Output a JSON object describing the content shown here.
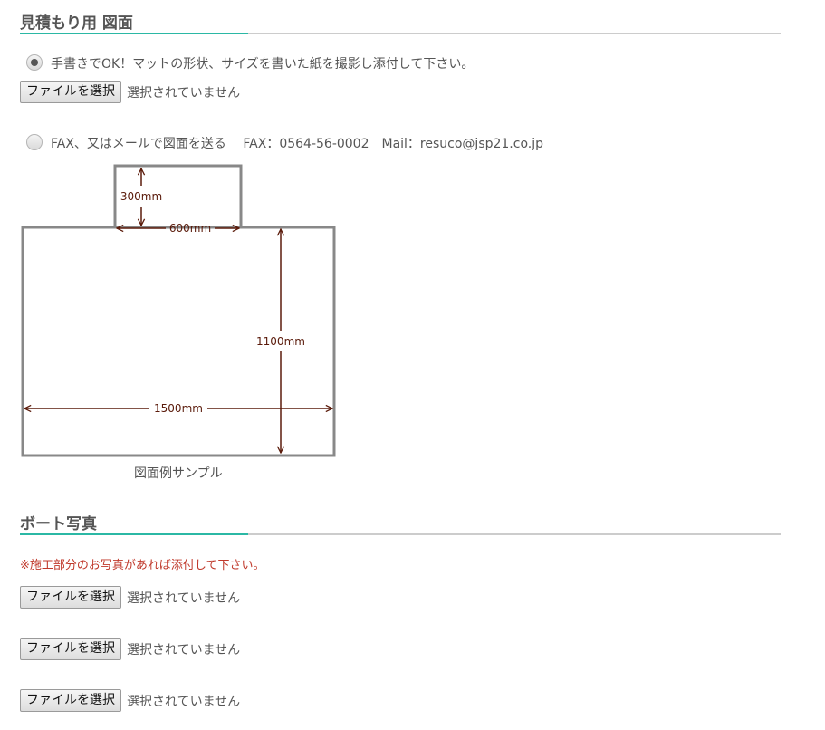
{
  "estimate_section": {
    "title": "見積もり用 図面",
    "option_handwritten": {
      "label": "手書きでOK！マットの形状、サイズを書いた紙を撮影し添付して下さい。",
      "checked": true
    },
    "file_input": {
      "button_label": "ファイルを選択",
      "status": "選択されていません"
    },
    "option_fax_mail": {
      "label": "FAX、又はメールで図面を送る　 FAX：0564-56-0002　Mail：resuco@jsp21.co.jp",
      "checked": false
    },
    "diagram": {
      "dim_top_height": "300mm",
      "dim_top_width": "600mm",
      "dim_main_height": "1100mm",
      "dim_main_width": "1500mm",
      "caption": "図面例サンプル",
      "outline_color": "#888888",
      "arrow_color": "#5a1a0a"
    }
  },
  "boat_section": {
    "title": "ボート写真",
    "notice": "※施工部分のお写真があれば添付して下さい。",
    "file_inputs": [
      {
        "button_label": "ファイルを選択",
        "status": "選択されていません"
      },
      {
        "button_label": "ファイルを選択",
        "status": "選択されていません"
      },
      {
        "button_label": "ファイルを選択",
        "status": "選択されていません"
      }
    ]
  },
  "colors": {
    "accent": "#2bb8a5",
    "notice": "#c0392b"
  }
}
